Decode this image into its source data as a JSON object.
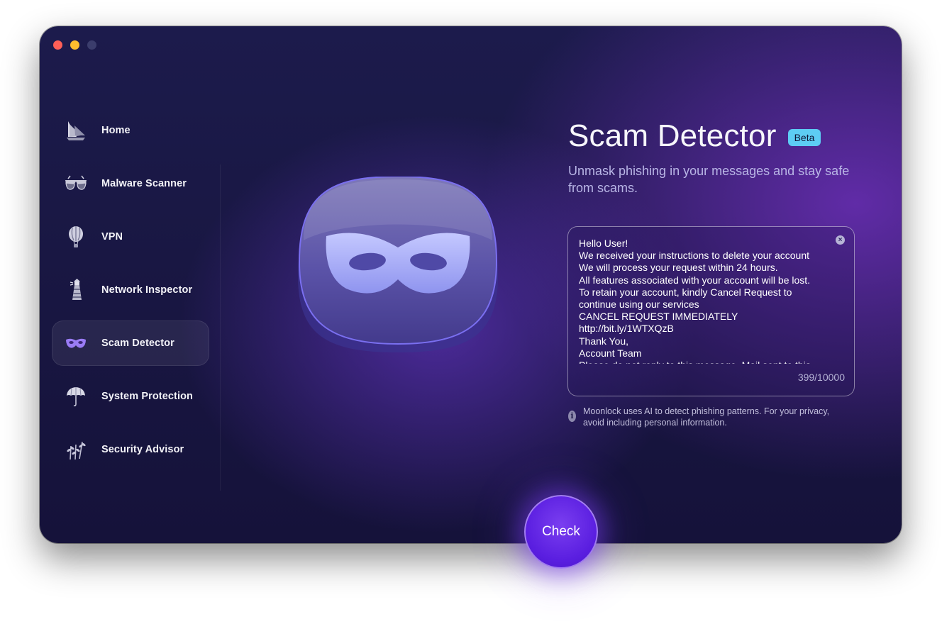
{
  "window": {
    "controls": [
      "close",
      "minimize",
      "zoom"
    ]
  },
  "sidebar": {
    "items": [
      {
        "label": "Home",
        "icon": "sailboat-icon",
        "active": false
      },
      {
        "label": "Malware Scanner",
        "icon": "glasses-icon",
        "active": false
      },
      {
        "label": "VPN",
        "icon": "hot-air-balloon-icon",
        "active": false
      },
      {
        "label": "Network Inspector",
        "icon": "lighthouse-icon",
        "active": false
      },
      {
        "label": "Scam Detector",
        "icon": "mask-icon",
        "active": true
      },
      {
        "label": "System Protection",
        "icon": "umbrella-icon",
        "active": false
      },
      {
        "label": "Security Advisor",
        "icon": "plant-icon",
        "active": false
      }
    ]
  },
  "main": {
    "title": "Scam Detector",
    "badge": "Beta",
    "subtitle": "Unmask phishing in your messages and stay safe from scams.",
    "message": {
      "value": "Hello User!\nWe received your instructions to delete your account\nWe will process your request within 24 hours.\nAll features associated with your account will be lost.\nTo retain your account, kindly Cancel Request to continue using our services\nCANCEL REQUEST IMMEDIATELY\nhttp://bit.ly/1WTXQzB\nThank You,\nAccount Team\nPlease do not reply to this message. Mail sent to this",
      "counter": "399/10000"
    },
    "privacy_note": "Moonlock uses AI to detect phishing patterns. For your privacy, avoid including personal information.",
    "check_button": "Check"
  },
  "colors": {
    "accent": "#5a1ee0",
    "badge": "#5dcdf4",
    "background": "#1a1845"
  }
}
